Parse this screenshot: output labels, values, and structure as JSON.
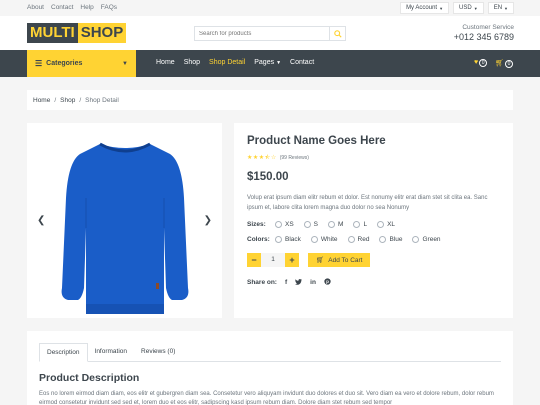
{
  "topbar": {
    "links": [
      "About",
      "Contact",
      "Help",
      "FAQs"
    ],
    "account": "My Account",
    "currency": "USD",
    "language": "EN"
  },
  "header": {
    "logo_part1": "MULTI",
    "logo_part2": "SHOP",
    "search_placeholder": "Search for products",
    "cs_title": "Customer Service",
    "cs_phone": "+012 345 6789"
  },
  "nav": {
    "categories": "Categories",
    "items": [
      "Home",
      "Shop",
      "Shop Detail",
      "Pages",
      "Contact"
    ],
    "active": "Shop Detail",
    "wishlist_count": "0",
    "cart_count": "0"
  },
  "breadcrumb": [
    "Home",
    "Shop",
    "Shop Detail"
  ],
  "product": {
    "title": "Product Name Goes Here",
    "rating": 3.5,
    "reviews": "(99 Reviews)",
    "price": "$150.00",
    "description": "Volup erat ipsum diam elitr rebum et dolor. Est nonumy elitr erat diam stet sit clita ea. Sanc ipsum et, labore clita lorem magna duo dolor no sea Nonumy",
    "sizes_label": "Sizes:",
    "sizes": [
      "XS",
      "S",
      "M",
      "L",
      "XL"
    ],
    "colors_label": "Colors:",
    "colors": [
      "Black",
      "White",
      "Red",
      "Blue",
      "Green"
    ],
    "quantity": "1",
    "add_to_cart": "Add To Cart",
    "share_label": "Share on:"
  },
  "tabs": {
    "items": [
      "Description",
      "Information",
      "Reviews (0)"
    ],
    "active": "Description",
    "section_title": "Product Description",
    "section_text": "Eos no lorem eirmod diam diam, eos elitr et gubergren diam sea. Consetetur vero aliquyam invidunt duo dolores et duo sit. Vero diam ea vero et dolore rebum, dolor rebum eirmod consetetur invidunt sed sed et, lorem duo et eos elitr, sadipscing kasd ipsum rebum diam. Dolore diam stet rebum sed tempor"
  },
  "colors": {
    "accent": "#FFD333",
    "dark": "#3D464D",
    "muted": "#6C757D",
    "product": "#1A5DC8"
  }
}
